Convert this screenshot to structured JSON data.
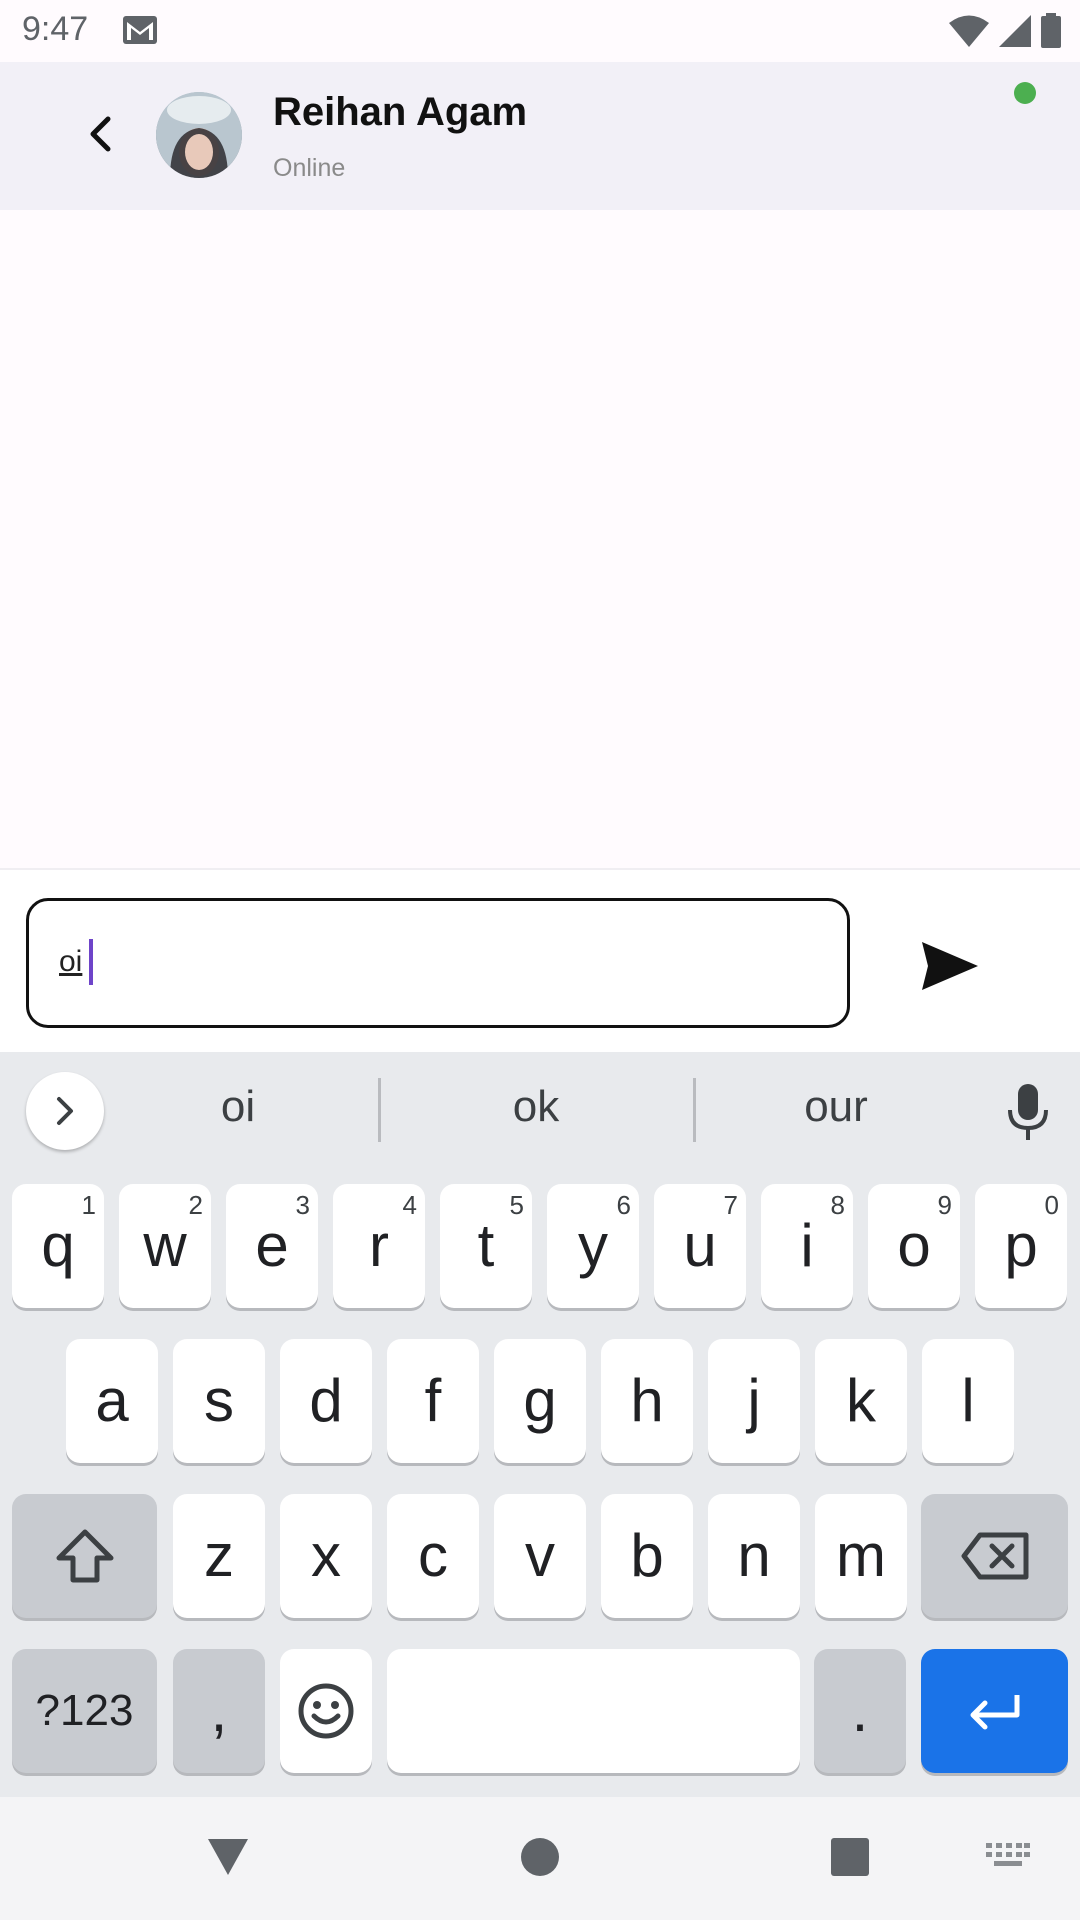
{
  "status_bar": {
    "time": "9:47"
  },
  "header": {
    "contact_name": "Reihan Agam",
    "contact_status": "Online",
    "online_color": "#4CAF50"
  },
  "composer": {
    "input_value": "oi"
  },
  "keyboard": {
    "suggestions": [
      "oi",
      "ok",
      "our"
    ],
    "row1": [
      {
        "key": "q",
        "hint": "1"
      },
      {
        "key": "w",
        "hint": "2"
      },
      {
        "key": "e",
        "hint": "3"
      },
      {
        "key": "r",
        "hint": "4"
      },
      {
        "key": "t",
        "hint": "5"
      },
      {
        "key": "y",
        "hint": "6"
      },
      {
        "key": "u",
        "hint": "7"
      },
      {
        "key": "i",
        "hint": "8"
      },
      {
        "key": "o",
        "hint": "9"
      },
      {
        "key": "p",
        "hint": "0"
      }
    ],
    "row2": [
      "a",
      "s",
      "d",
      "f",
      "g",
      "h",
      "j",
      "k",
      "l"
    ],
    "row3": [
      "z",
      "x",
      "c",
      "v",
      "b",
      "n",
      "m"
    ],
    "symbols_label": "?123",
    "comma_label": ",",
    "period_label": ".",
    "enter_color": "#1A73E8"
  },
  "colors": {
    "app_bar": "#F2F0F7",
    "background": "#FFFBFE",
    "cursor": "#6E44C9"
  }
}
